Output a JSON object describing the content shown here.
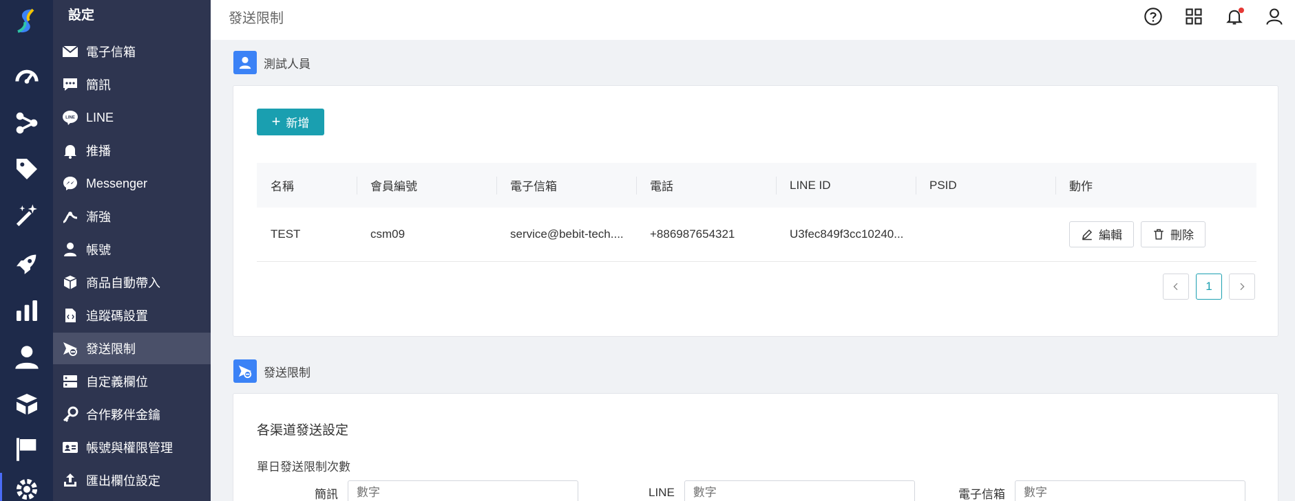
{
  "header": {
    "title": "發送限制"
  },
  "menu": {
    "title": "設定",
    "items": [
      {
        "label": "電子信箱",
        "icon": "envelope-icon"
      },
      {
        "label": "簡訊",
        "icon": "chat-icon"
      },
      {
        "label": "LINE",
        "icon": "line-icon"
      },
      {
        "label": "推播",
        "icon": "bell-icon"
      },
      {
        "label": "Messenger",
        "icon": "messenger-icon"
      },
      {
        "label": "漸強",
        "icon": "growth-icon"
      },
      {
        "label": "帳號",
        "icon": "user-icon"
      },
      {
        "label": "商品自動帶入",
        "icon": "box-icon"
      },
      {
        "label": "追蹤碼設置",
        "icon": "code-icon"
      },
      {
        "label": "發送限制",
        "icon": "send-limit-icon",
        "active": true
      },
      {
        "label": "自定義欄位",
        "icon": "fields-icon"
      },
      {
        "label": "合作夥伴金鑰",
        "icon": "key-icon"
      },
      {
        "label": "帳號與權限管理",
        "icon": "id-card-icon"
      },
      {
        "label": "匯出欄位設定",
        "icon": "export-icon"
      }
    ]
  },
  "testers": {
    "section_title": "測試人員",
    "add_label": "新增",
    "columns": [
      "名稱",
      "會員編號",
      "電子信箱",
      "電話",
      "LINE ID",
      "PSID",
      "動作"
    ],
    "rows": [
      {
        "name": "TEST",
        "member_id": "csm09",
        "email": "service@bebit-tech....",
        "phone": "+886987654321",
        "line_id": "U3fec849f3cc10240...",
        "psid": ""
      }
    ],
    "edit_label": "編輯",
    "delete_label": "刪除",
    "current_page": "1"
  },
  "limits": {
    "section_title": "發送限制",
    "subtitle": "各渠道發送設定",
    "daily_label": "單日發送限制次數",
    "fields": [
      {
        "label": "簡訊",
        "placeholder": "數字"
      },
      {
        "label": "LINE",
        "placeholder": "數字"
      },
      {
        "label": "電子信箱",
        "placeholder": "數字"
      }
    ]
  },
  "colors": {
    "rail": "#1e2a4a",
    "menu": "#2e3550",
    "accent": "#1a9fb0",
    "badge": "#3b82f6"
  }
}
